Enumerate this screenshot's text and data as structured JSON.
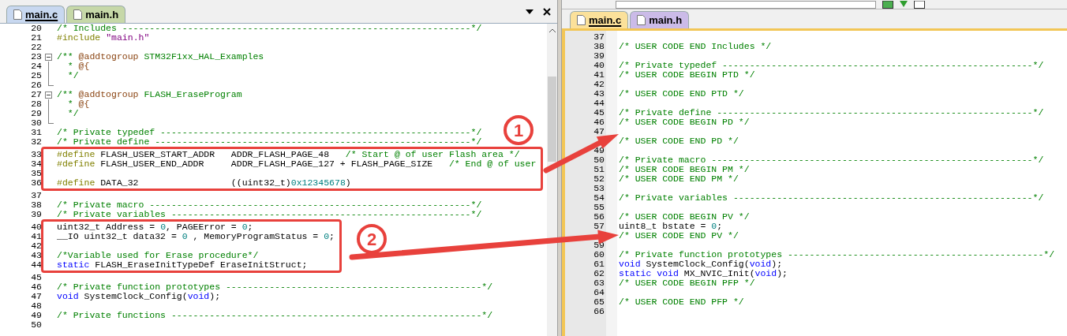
{
  "left_editor": {
    "tabs": [
      {
        "label": "main.c",
        "selected": true
      },
      {
        "label": "main.h",
        "selected": false
      }
    ],
    "blocks": [
      {
        "highlighted": false,
        "lines": [
          {
            "number": "20",
            "segments": [
              {
                "kind": "comment",
                "text": "/* Includes ----------------------------------------------------------------*/"
              }
            ]
          },
          {
            "number": "21",
            "segments": [
              {
                "kind": "directive",
                "text": "#include "
              },
              {
                "kind": "string",
                "text": "\"main.h\""
              }
            ]
          },
          {
            "number": "22"
          },
          {
            "number": "23",
            "kind": "fold_start",
            "segments": [
              {
                "kind": "comment",
                "text": "/** "
              },
              {
                "kind": "doc",
                "text": "@addtogroup"
              },
              {
                "kind": "comment",
                "text": " STM32F1xx_HAL_Examples"
              }
            ]
          },
          {
            "number": "24",
            "kind": "fold_body",
            "segments": [
              {
                "kind": "comment",
                "text": "  * "
              },
              {
                "kind": "doc",
                "text": "@{"
              }
            ]
          },
          {
            "number": "25",
            "kind": "fold_body",
            "segments": [
              {
                "kind": "comment",
                "text": "  */"
              }
            ]
          },
          {
            "number": "26",
            "kind": "fold_end"
          },
          {
            "number": "27",
            "kind": "fold_start",
            "segments": [
              {
                "kind": "comment",
                "text": "/** "
              },
              {
                "kind": "doc",
                "text": "@addtogroup"
              },
              {
                "kind": "comment",
                "text": " FLASH_EraseProgram"
              }
            ]
          },
          {
            "number": "28",
            "kind": "fold_body",
            "segments": [
              {
                "kind": "comment",
                "text": "  * "
              },
              {
                "kind": "doc",
                "text": "@{"
              }
            ]
          },
          {
            "number": "29",
            "kind": "fold_body",
            "segments": [
              {
                "kind": "comment",
                "text": "  */"
              }
            ]
          },
          {
            "number": "30",
            "kind": "fold_end"
          },
          {
            "number": "31",
            "segments": [
              {
                "kind": "comment",
                "text": "/* Private typedef ---------------------------------------------------------*/"
              }
            ]
          },
          {
            "number": "32",
            "segments": [
              {
                "kind": "comment",
                "text": "/* Private define ----------------------------------------------------------*/"
              }
            ]
          }
        ]
      },
      {
        "highlighted": true,
        "lines": [
          {
            "number": "33",
            "segments": [
              {
                "kind": "directive",
                "text": "#define"
              },
              {
                "kind": "plain",
                "text": " FLASH_USER_START_ADDR   ADDR_FLASH_PAGE_48   "
              },
              {
                "kind": "comment",
                "text": "/* Start @ of user Flash area */"
              }
            ]
          },
          {
            "number": "34",
            "segments": [
              {
                "kind": "directive",
                "text": "#define"
              },
              {
                "kind": "plain",
                "text": " FLASH_USER_END_ADDR     ADDR_FLASH_PAGE_127 + FLASH_PAGE_SIZE   "
              },
              {
                "kind": "comment",
                "text": "/* End @ of user"
              }
            ]
          },
          {
            "number": "35"
          },
          {
            "number": "36",
            "segments": [
              {
                "kind": "directive",
                "text": "#define"
              },
              {
                "kind": "plain",
                "text": " DATA_32                 ((uint32_t)"
              },
              {
                "kind": "number",
                "text": "0x12345678"
              },
              {
                "kind": "plain",
                "text": ")"
              }
            ]
          }
        ]
      },
      {
        "highlighted": false,
        "lines": [
          {
            "number": "37"
          },
          {
            "number": "38",
            "segments": [
              {
                "kind": "comment",
                "text": "/* Private macro -----------------------------------------------------------*/"
              }
            ]
          },
          {
            "number": "39",
            "segments": [
              {
                "kind": "comment",
                "text": "/* Private variables -------------------------------------------------------*/"
              }
            ]
          }
        ]
      },
      {
        "highlighted": true,
        "lines": [
          {
            "number": "40",
            "segments": [
              {
                "kind": "plain",
                "text": "uint32_t Address = "
              },
              {
                "kind": "number",
                "text": "0"
              },
              {
                "kind": "plain",
                "text": ", PAGEError = "
              },
              {
                "kind": "number",
                "text": "0"
              },
              {
                "kind": "plain",
                "text": ";"
              }
            ]
          },
          {
            "number": "41",
            "segments": [
              {
                "kind": "plain",
                "text": "__IO uint32_t data32 = "
              },
              {
                "kind": "number",
                "text": "0"
              },
              {
                "kind": "plain",
                "text": " , MemoryProgramStatus = "
              },
              {
                "kind": "number",
                "text": "0"
              },
              {
                "kind": "plain",
                "text": ";"
              }
            ]
          },
          {
            "number": "42"
          },
          {
            "number": "43",
            "segments": [
              {
                "kind": "comment",
                "text": "/*Variable used for Erase procedure*/"
              }
            ]
          },
          {
            "number": "44",
            "segments": [
              {
                "kind": "keyword",
                "text": "static"
              },
              {
                "kind": "plain",
                "text": " FLASH_EraseInitTypeDef EraseInitStruct;"
              }
            ]
          }
        ]
      },
      {
        "highlighted": false,
        "lines": [
          {
            "number": "45"
          },
          {
            "number": "46",
            "segments": [
              {
                "kind": "comment",
                "text": "/* Private function prototypes -----------------------------------------------*/"
              }
            ]
          },
          {
            "number": "47",
            "segments": [
              {
                "kind": "keyword",
                "text": "void"
              },
              {
                "kind": "plain",
                "text": " SystemClock_Config("
              },
              {
                "kind": "keyword",
                "text": "void"
              },
              {
                "kind": "plain",
                "text": ");"
              }
            ]
          },
          {
            "number": "48"
          },
          {
            "number": "49",
            "segments": [
              {
                "kind": "comment",
                "text": "/* Private functions ---------------------------------------------------------*/"
              }
            ]
          },
          {
            "number": "50"
          }
        ]
      }
    ]
  },
  "right_editor": {
    "tabs": [
      {
        "label": "main.c",
        "selected": true
      },
      {
        "label": "main.h",
        "selected": false
      }
    ],
    "lines": [
      {
        "number": "37"
      },
      {
        "number": "38",
        "segments": [
          {
            "kind": "comment",
            "text": "/* USER CODE END Includes */"
          }
        ]
      },
      {
        "number": "39"
      },
      {
        "number": "40",
        "segments": [
          {
            "kind": "comment",
            "text": "/* Private typedef ---------------------------------------------------------*/"
          }
        ]
      },
      {
        "number": "41",
        "segments": [
          {
            "kind": "comment",
            "text": "/* USER CODE BEGIN PTD */"
          }
        ]
      },
      {
        "number": "42"
      },
      {
        "number": "43",
        "segments": [
          {
            "kind": "comment",
            "text": "/* USER CODE END PTD */"
          }
        ]
      },
      {
        "number": "44"
      },
      {
        "number": "45",
        "segments": [
          {
            "kind": "comment",
            "text": "/* Private define ----------------------------------------------------------*/"
          }
        ]
      },
      {
        "number": "46",
        "segments": [
          {
            "kind": "comment",
            "text": "/* USER CODE BEGIN PD */"
          }
        ]
      },
      {
        "number": "47"
      },
      {
        "segments": [
          {
            "kind": "comment",
            "text": "/* USER CODE END PD */"
          }
        ]
      },
      {
        "number": "49"
      },
      {
        "number": "50",
        "segments": [
          {
            "kind": "comment",
            "text": "/* Private macro -----------------------------------------------------------*/"
          }
        ]
      },
      {
        "number": "51",
        "segments": [
          {
            "kind": "comment",
            "text": "/* USER CODE BEGIN PM */"
          }
        ]
      },
      {
        "number": "52",
        "segments": [
          {
            "kind": "comment",
            "text": "/* USER CODE END PM */"
          }
        ]
      },
      {
        "number": "53"
      },
      {
        "number": "54",
        "segments": [
          {
            "kind": "comment",
            "text": "/* Private variables -------------------------------------------------------*/"
          }
        ]
      },
      {
        "number": "55"
      },
      {
        "number": "56",
        "segments": [
          {
            "kind": "comment",
            "text": "/* USER CODE BEGIN PV */"
          }
        ]
      },
      {
        "number": "57",
        "segments": [
          {
            "kind": "plain",
            "text": "uint8_t bstate = "
          },
          {
            "kind": "number",
            "text": "0"
          },
          {
            "kind": "plain",
            "text": ";"
          }
        ]
      },
      {
        "segments": [
          {
            "kind": "comment",
            "text": "/* USER CODE END PV */"
          }
        ]
      },
      {
        "number": "59"
      },
      {
        "number": "60",
        "segments": [
          {
            "kind": "comment",
            "text": "/* Private function prototypes -----------------------------------------------*/"
          }
        ]
      },
      {
        "number": "61",
        "segments": [
          {
            "kind": "keyword",
            "text": "void"
          },
          {
            "kind": "plain",
            "text": " SystemClock_Config("
          },
          {
            "kind": "keyword",
            "text": "void"
          },
          {
            "kind": "plain",
            "text": ");"
          }
        ]
      },
      {
        "number": "62",
        "segments": [
          {
            "kind": "keyword",
            "text": "static void"
          },
          {
            "kind": "plain",
            "text": " MX_NVIC_Init("
          },
          {
            "kind": "keyword",
            "text": "void"
          },
          {
            "kind": "plain",
            "text": ");"
          }
        ]
      },
      {
        "number": "63",
        "segments": [
          {
            "kind": "comment",
            "text": "/* USER CODE BEGIN PFP */"
          }
        ]
      },
      {
        "number": "64"
      },
      {
        "number": "65",
        "segments": [
          {
            "kind": "comment",
            "text": "/* USER CODE END PFP */"
          }
        ]
      },
      {
        "number": "66"
      }
    ]
  },
  "callouts": [
    {
      "label": "1"
    },
    {
      "label": "2"
    }
  ]
}
